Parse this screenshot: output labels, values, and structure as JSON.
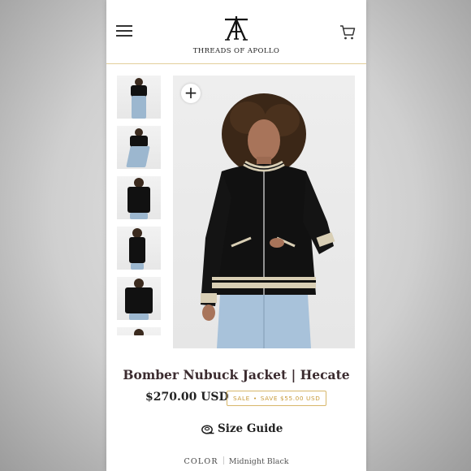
{
  "brand": {
    "name": "THREADS OF APOLLO"
  },
  "header": {
    "menu_icon": "hamburger-menu-icon",
    "cart_icon": "shopping-cart-icon"
  },
  "gallery": {
    "zoom_symbol": "+",
    "thumbnail_count": 6
  },
  "product": {
    "title": "Bomber Nubuck Jacket | Hecate",
    "price": "$270.00 USD",
    "sale_label": "SALE",
    "sale_separator": "•",
    "save_text": "SAVE $55.00 USD",
    "size_guide_label": "Size Guide",
    "color_label": "COLOR",
    "color_value": "Midnight Black"
  },
  "colors": {
    "accent_gold": "#d7b76a",
    "title_color": "#3b2b2f",
    "header_rule": "#e3cf9a"
  }
}
